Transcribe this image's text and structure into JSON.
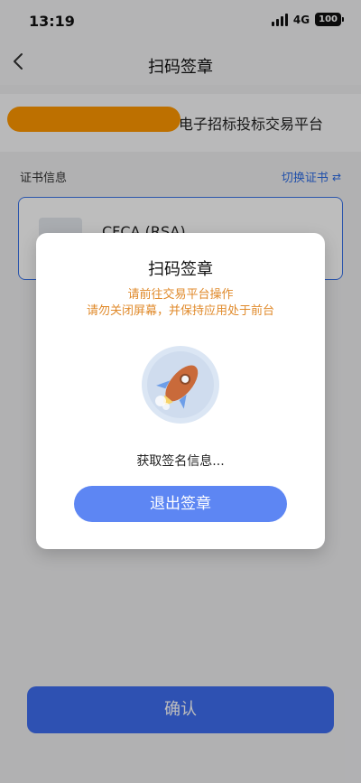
{
  "status_bar": {
    "time": "13:19",
    "network": "4G",
    "battery": "100"
  },
  "nav": {
    "title": "扫码签章"
  },
  "platform": {
    "name": "电子招标投标交易平台"
  },
  "cert": {
    "label": "证书信息",
    "switch_label": "切换证书",
    "name": "CFCA (RSA)"
  },
  "confirm": {
    "label": "确认"
  },
  "modal": {
    "title": "扫码签章",
    "notice_line1": "请前往交易平台操作",
    "notice_line2": "请勿关闭屏幕，并保持应用处于前台",
    "status": "获取签名信息...",
    "exit_label": "退出签章"
  },
  "colors": {
    "accent": "#3f6ef0",
    "warning": "#e08a2b",
    "redaction": "#ff9800"
  }
}
